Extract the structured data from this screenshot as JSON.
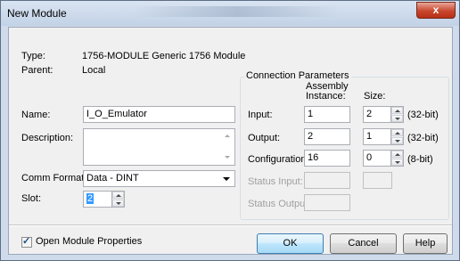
{
  "window": {
    "title": "New Module",
    "close_glyph": "x"
  },
  "info": {
    "type_label": "Type:",
    "type_value": "1756-MODULE Generic 1756 Module",
    "parent_label": "Parent:",
    "parent_value": "Local"
  },
  "form": {
    "name_label": "Name:",
    "name_value": "I_O_Emulator",
    "description_label": "Description:",
    "description_value": "",
    "comm_format_label": "Comm Format:",
    "comm_format_value": "Data - DINT",
    "slot_label": "Slot:",
    "slot_value": "2"
  },
  "connection": {
    "legend": "Connection Parameters",
    "assembly_header_line1": "Assembly",
    "assembly_header_line2": "Instance:",
    "size_header": "Size:",
    "rows": [
      {
        "label": "Input:",
        "instance": "1",
        "size": "2",
        "unit": "(32-bit)",
        "enabled": true
      },
      {
        "label": "Output:",
        "instance": "2",
        "size": "1",
        "unit": "(32-bit)",
        "enabled": true
      },
      {
        "label": "Configuration:",
        "instance": "16",
        "size": "0",
        "unit": "(8-bit)",
        "enabled": true
      },
      {
        "label": "Status Input:",
        "instance": "",
        "size": "",
        "unit": "",
        "enabled": false
      },
      {
        "label": "Status Output:",
        "instance": "",
        "size": "",
        "unit": "",
        "enabled": false
      }
    ]
  },
  "footer": {
    "open_props_label": "Open Module Properties",
    "open_props_checked": true,
    "ok_label": "OK",
    "cancel_label": "Cancel",
    "help_label": "Help"
  }
}
